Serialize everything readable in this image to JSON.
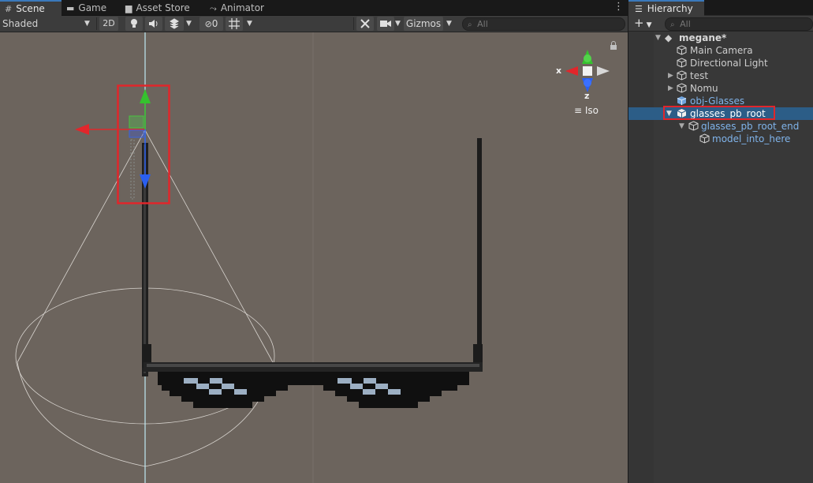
{
  "scene_tabs": [
    {
      "label": "Scene",
      "icon": "grid-icon",
      "active": true
    },
    {
      "label": "Game",
      "icon": "gamepad-icon",
      "active": false
    },
    {
      "label": "Asset Store",
      "icon": "shopping-bag-icon",
      "active": false
    },
    {
      "label": "Animator",
      "icon": "animator-icon",
      "active": false
    }
  ],
  "toolbar": {
    "shading_mode": "Shaded",
    "mode_2d": "2D",
    "hidden_count": "0",
    "gizmos_label": "Gizmos",
    "search_placeholder": "All"
  },
  "viewport": {
    "gizmo_axes": {
      "x": "x",
      "z": "z"
    },
    "projection_label": "Iso"
  },
  "hierarchy": {
    "tab_label": "Hierarchy",
    "add_label": "+",
    "search_placeholder": "All",
    "items": [
      {
        "label": "megane*",
        "kind": "scene",
        "expanded": true,
        "selected": false
      },
      {
        "label": "Main Camera",
        "kind": "object",
        "expanded": null,
        "selected": false
      },
      {
        "label": "Directional Light",
        "kind": "object",
        "expanded": null,
        "selected": false
      },
      {
        "label": "test",
        "kind": "object",
        "expanded": false,
        "selected": false
      },
      {
        "label": "Nomu",
        "kind": "object",
        "expanded": false,
        "selected": false
      },
      {
        "label": "obj-Glasses",
        "kind": "prefab",
        "expanded": null,
        "selected": false
      },
      {
        "label": "glasses_pb_root",
        "kind": "object",
        "expanded": true,
        "selected": true
      },
      {
        "label": "glasses_pb_root_end",
        "kind": "prefab",
        "expanded": true,
        "selected": false
      },
      {
        "label": "model_into_here",
        "kind": "prefab",
        "expanded": null,
        "selected": false
      }
    ]
  },
  "colors": {
    "viewport_bg": "#6c645d",
    "selection_bg": "#2c5d87",
    "prefab_text": "#7fb3ea",
    "highlight_box": "#e0262b",
    "axis_x": "#e2262b",
    "axis_y": "#35c22e",
    "axis_z": "#2a5ff0"
  }
}
